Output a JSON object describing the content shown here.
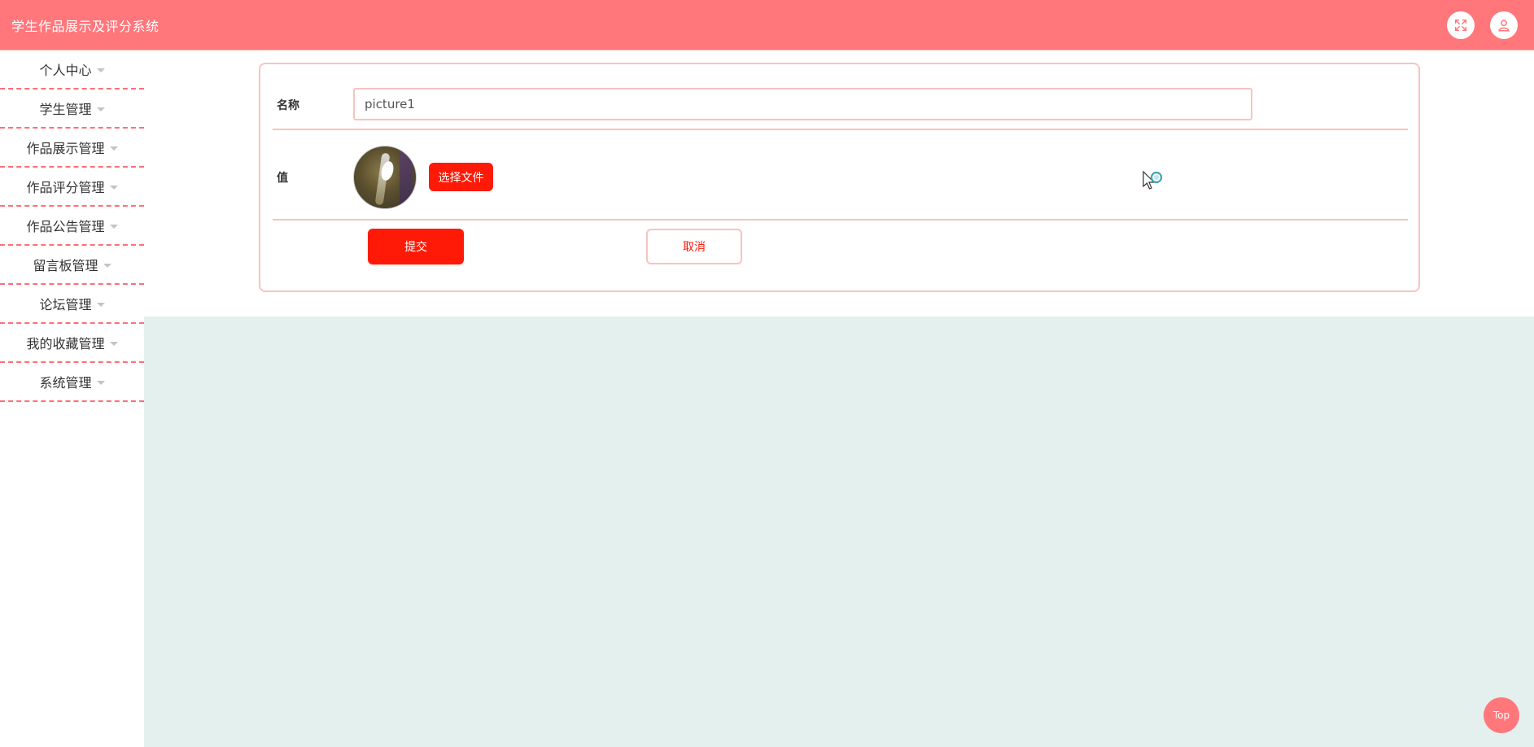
{
  "header": {
    "title": "学生作品展示及评分系统",
    "icons": [
      "fullscreen-icon",
      "user-icon"
    ]
  },
  "sidebar": {
    "items": [
      {
        "label": "个人中心"
      },
      {
        "label": "学生管理"
      },
      {
        "label": "作品展示管理"
      },
      {
        "label": "作品评分管理"
      },
      {
        "label": "作品公告管理"
      },
      {
        "label": "留言板管理"
      },
      {
        "label": "论坛管理"
      },
      {
        "label": "我的收藏管理"
      },
      {
        "label": "系统管理"
      }
    ]
  },
  "form": {
    "name_label": "名称",
    "name_value": "picture1",
    "value_label": "值",
    "file_button": "选择文件",
    "submit_button": "提交",
    "cancel_button": "取消"
  },
  "back_to_top": "Top",
  "colors": {
    "header_bg": "#ff767b",
    "accent_red": "#ff1a07",
    "border_pink": "#f8c3c0",
    "content_bg": "#e4f0ed"
  }
}
